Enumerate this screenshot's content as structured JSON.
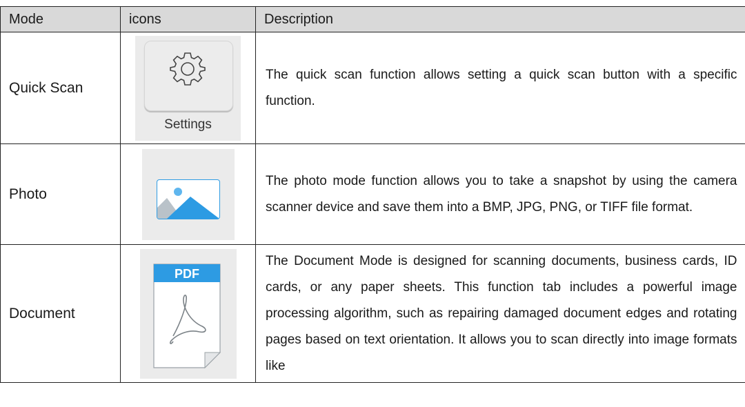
{
  "table": {
    "headers": {
      "mode": "Mode",
      "icons": "icons",
      "description": "Description"
    },
    "rows": [
      {
        "mode": "Quick Scan",
        "icon": "settings-gear-icon",
        "icon_label": "Settings",
        "description": "The quick scan function allows setting a quick scan button with a specific function."
      },
      {
        "mode": "Photo",
        "icon": "photo-image-icon",
        "description": "The photo mode function allows you to take a snapshot by using the camera scanner device and save them into a BMP, JPG, PNG, or TIFF file format."
      },
      {
        "mode": "Document",
        "icon": "pdf-document-icon",
        "icon_label": "PDF",
        "description": "The Document Mode is designed for scanning documents, business cards, ID cards, or any paper sheets. This function tab includes a powerful image processing algorithm, such as repairing damaged document edges and rotating pages based on text orientation. It allows you to scan directly into image formats like"
      }
    ]
  },
  "colors": {
    "header_bg": "#d9d9d9",
    "icon_bg": "#ebebeb",
    "accent_blue": "#2d9be3"
  }
}
